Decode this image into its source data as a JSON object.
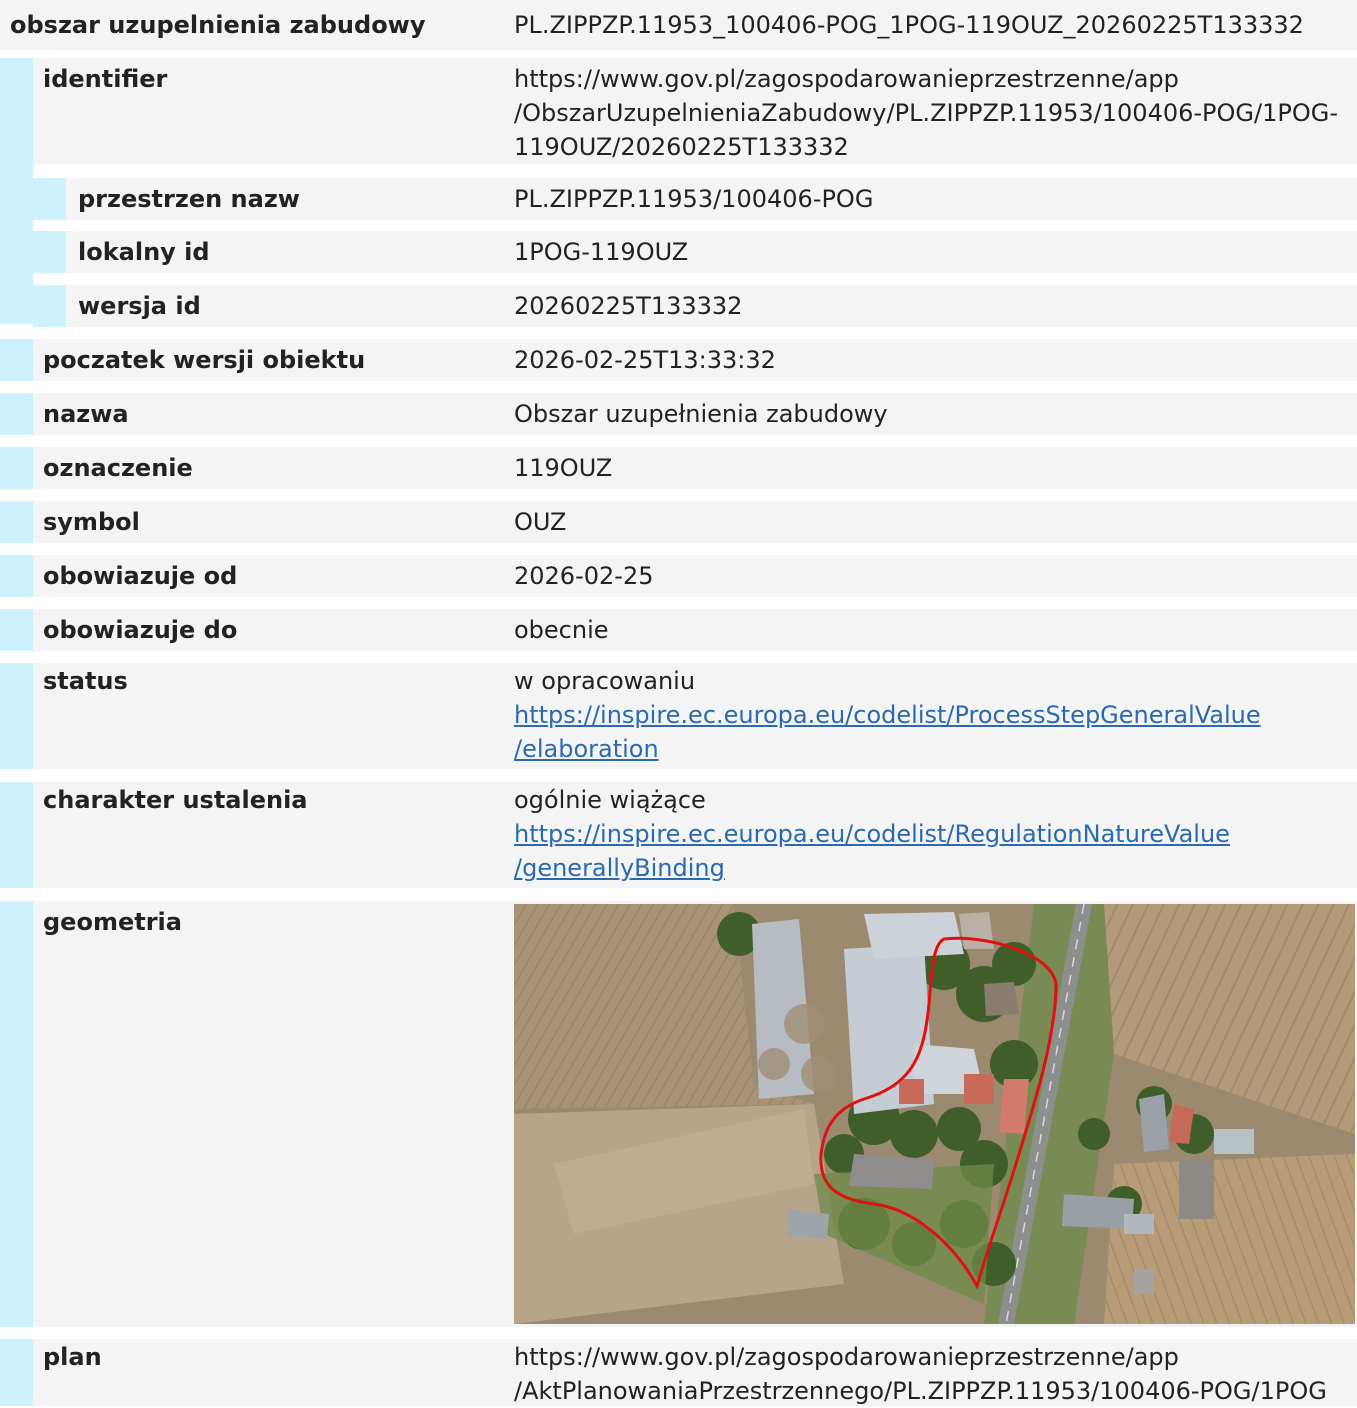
{
  "header": {
    "label": "obszar uzupelnienia zabudowy",
    "value": "PL.ZIPPZP.11953_100406-POG_1POG-119OUZ_20260225T133332"
  },
  "identifier": {
    "label": "identifier",
    "lines": [
      "https://www.gov.pl/zagospodarowanieprzestrzenne/app",
      "/ObszarUzupelnieniaZabudowy/PL.ZIPPZP.11953/100406-POG/1POG-",
      "119OUZ/20260225T133332"
    ],
    "fields": [
      {
        "label": "przestrzen nazw",
        "value": "PL.ZIPPZP.11953/100406-POG"
      },
      {
        "label": "lokalny id",
        "value": "1POG-119OUZ"
      },
      {
        "label": "wersja id",
        "value": "20260225T133332"
      }
    ]
  },
  "fields": [
    {
      "label": "poczatek wersji obiektu",
      "value": "2026-02-25T13:33:32"
    },
    {
      "label": "nazwa",
      "value": "Obszar uzupełnienia zabudowy"
    },
    {
      "label": "oznaczenie",
      "value": "119OUZ"
    },
    {
      "label": "symbol",
      "value": "OUZ"
    },
    {
      "label": "obowiazuje od",
      "value": "2026-02-25"
    },
    {
      "label": "obowiazuje do",
      "value": "obecnie"
    }
  ],
  "status": {
    "label": "status",
    "value": "w opracowaniu",
    "link_lines": [
      "https://inspire.ec.europa.eu/codelist/ProcessStepGeneralValue",
      "/elaboration"
    ]
  },
  "charakter": {
    "label": "charakter ustalenia",
    "value": "ogólnie wiążące",
    "link_lines": [
      "https://inspire.ec.europa.eu/codelist/RegulationNatureValue",
      "/generallyBinding"
    ]
  },
  "geometria": {
    "label": "geometria"
  },
  "plan": {
    "label": "plan",
    "lines": [
      "https://www.gov.pl/zagospodarowanieprzestrzenne/app",
      "/AktPlanowaniaPrzestrzennego/PL.ZIPPZP.11953/100406-POG/1POG"
    ]
  },
  "colors": {
    "row_bg": "#f4f4f4",
    "indent_bar": "#cdf2fd",
    "link": "#2a6ab0",
    "outline": "#e01010"
  }
}
